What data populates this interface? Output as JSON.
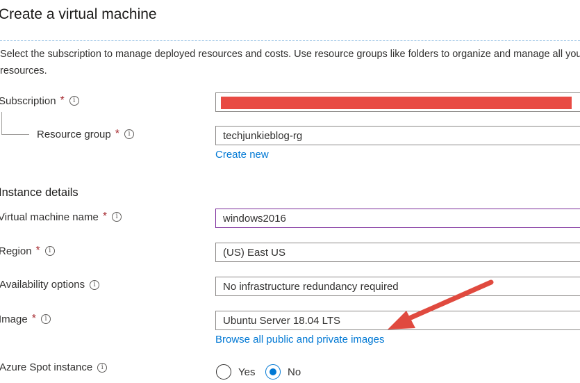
{
  "page": {
    "title": "Create a virtual machine"
  },
  "description": "Select the subscription to manage deployed resources and costs. Use resource groups like folders to organize and manage all your resources.",
  "subscription": {
    "label": "Subscription",
    "required": "*",
    "value": ""
  },
  "resource_group": {
    "label": "Resource group",
    "required": "*",
    "value": "techjunkieblog-rg",
    "create_new": "Create new"
  },
  "instance_details": {
    "heading": "Instance details",
    "vm_name": {
      "label": "Virtual machine name",
      "required": "*",
      "value": "windows2016"
    },
    "region": {
      "label": "Region",
      "required": "*",
      "value": "(US) East US"
    },
    "availability": {
      "label": "Availability options",
      "value": "No infrastructure redundancy required"
    },
    "image": {
      "label": "Image",
      "required": "*",
      "value": "Ubuntu Server 18.04 LTS",
      "browse_link": "Browse all public and private images"
    },
    "spot": {
      "label": "Azure Spot instance",
      "options": [
        "Yes",
        "No"
      ],
      "selected": "No"
    }
  },
  "info_glyph": "i",
  "colors": {
    "accent": "#0078d4",
    "required": "#a4262c",
    "annotation_arrow": "#e04a3f",
    "redaction": "#e84b44"
  }
}
